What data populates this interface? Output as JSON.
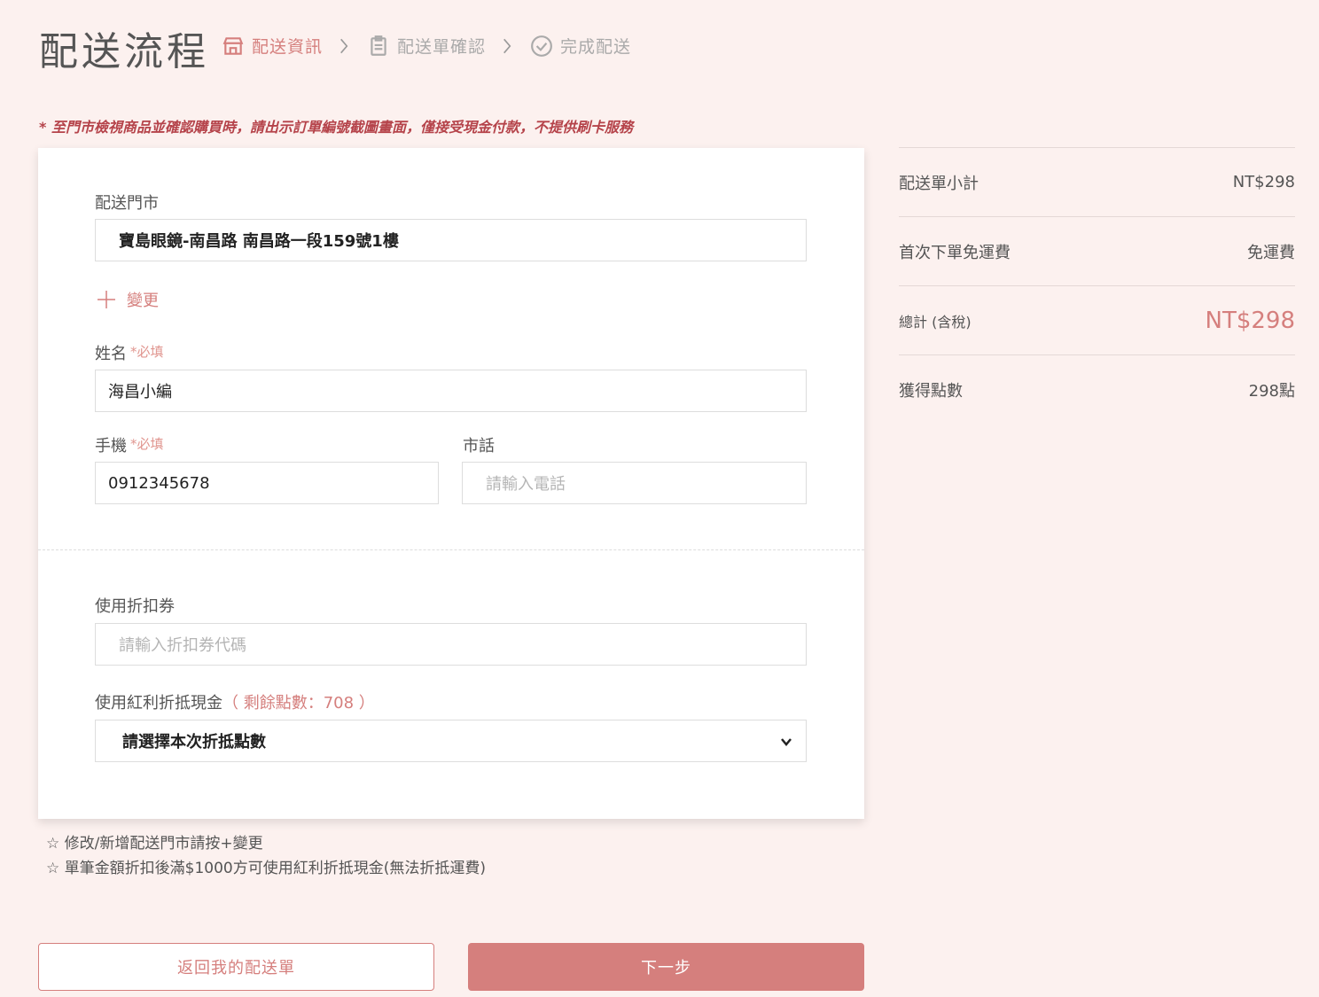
{
  "page": {
    "title": "配送流程",
    "steps": [
      {
        "label": "配送資訊",
        "icon": "store-icon",
        "active": true
      },
      {
        "label": "配送單確認",
        "icon": "clipboard-icon",
        "active": false
      },
      {
        "label": "完成配送",
        "icon": "check-circle-icon",
        "active": false
      }
    ],
    "notice": "* 至門市檢視商品並確認購買時，請出示訂單編號截圖畫面，僅接受現金付款，不提供刷卡服務"
  },
  "form": {
    "store_label": "配送門市",
    "store_value": "寶島眼鏡-南昌路 南昌路一段159號1樓",
    "change_label": "變更",
    "name_label": "姓名",
    "required_tag": "*必填",
    "name_value": "海昌小編",
    "mobile_label": "手機",
    "mobile_value": "0912345678",
    "phone_label": "市話",
    "phone_placeholder": "請輸入電話",
    "coupon_label": "使用折扣券",
    "coupon_placeholder": "請輸入折扣券代碼",
    "bonus_label": "使用紅利折抵現金",
    "bonus_remaining": "（ 剩餘點數：708 ）",
    "bonus_select_value": "請選擇本次折抵點數"
  },
  "footnotes": [
    "☆ 修改/新增配送門市請按+變更",
    "☆ 單筆金額折扣後滿$1000方可使用紅利折抵現金(無法折抵運費)"
  ],
  "buttons": {
    "back": "返回我的配送單",
    "next": "下一步"
  },
  "summary": {
    "subtotal_label": "配送單小計",
    "subtotal_value": "NT$298",
    "shipping_label": "首次下單免運費",
    "shipping_value": "免運費",
    "total_label": "總計 (含稅)",
    "total_value": "NT$298",
    "points_label": "獲得點數",
    "points_value": "298點"
  },
  "colors": {
    "accent": "#d57f7d",
    "background": "#fcf1ef",
    "notice": "#b5434a"
  }
}
